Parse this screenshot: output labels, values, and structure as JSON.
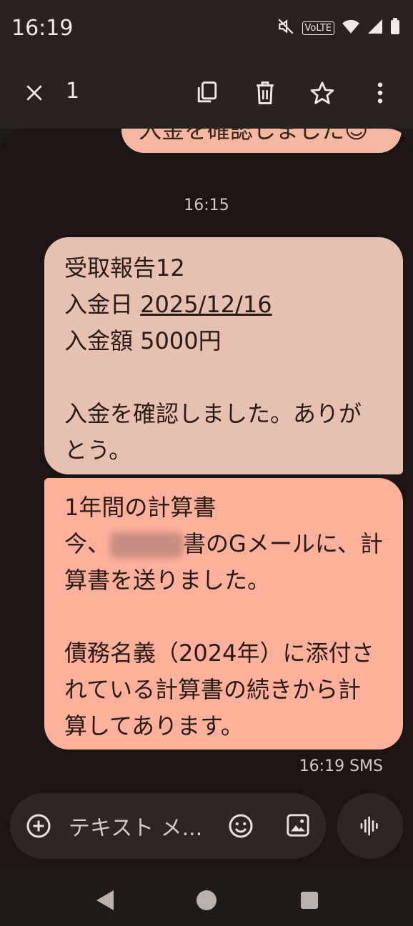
{
  "status": {
    "time": "16:19",
    "volte": "VoLTE"
  },
  "toolbar": {
    "selected_count": "1"
  },
  "messages": {
    "top_partial": "入金を確認しました😊",
    "timestamp": "16:15",
    "received": {
      "line1": "受取報告12",
      "line2_prefix": "入金日 ",
      "line2_link": "2025/12/16",
      "line3": "入金額 5000円",
      "line4": "入金を確認しました。ありが",
      "line5": "とう。"
    },
    "sent": {
      "line1": "1年間の計算書",
      "line2_prefix": "今、",
      "line2_suffix": "書のGメールに、計",
      "line3": "算書を送りました。",
      "line4": "債務名義（2024年）に添付さ",
      "line5": "れている計算書の続きから計",
      "line6": "算してあります。"
    },
    "meta": "16:19 SMS"
  },
  "compose": {
    "placeholder": "テキスト メ..."
  }
}
